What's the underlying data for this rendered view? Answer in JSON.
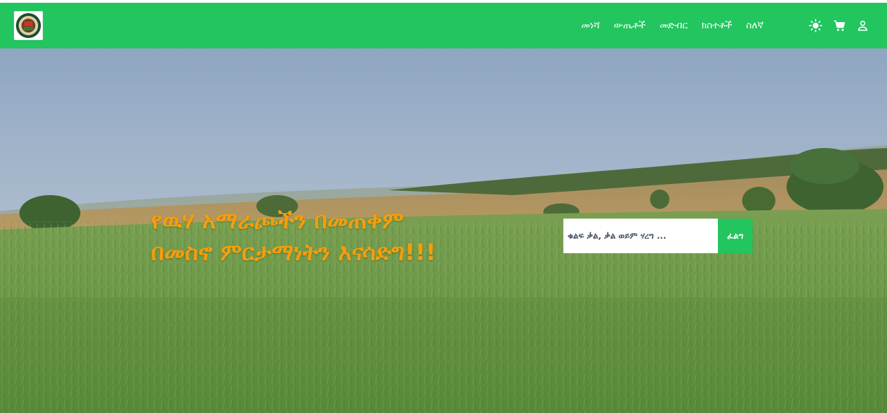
{
  "navbar": {
    "background": "#22c55e",
    "logo_icon": "logo-emblem",
    "links": [
      {
        "label": "መነሻ"
      },
      {
        "label": "ውጤቶች"
      },
      {
        "label": "መድብር"
      },
      {
        "label": "ክስተቶች"
      },
      {
        "label": "ስለኛ"
      }
    ],
    "icons": [
      "sun-icon",
      "cart-icon",
      "user-icon"
    ]
  },
  "hero": {
    "title_line_1": "የዉሃ አማራጮችን በመጠቀም",
    "title_line_2": "በመስኖ ምርታማነትን እናሳድግ!!!",
    "title_color": "#f59e0b",
    "background": "wheat-field-photo"
  },
  "search": {
    "placeholder": "ቁልፍ ቃል, ቃል ወይም ሃረግ ...",
    "value": "",
    "button_label": "ፈልግ",
    "button_color": "#22c55e"
  }
}
